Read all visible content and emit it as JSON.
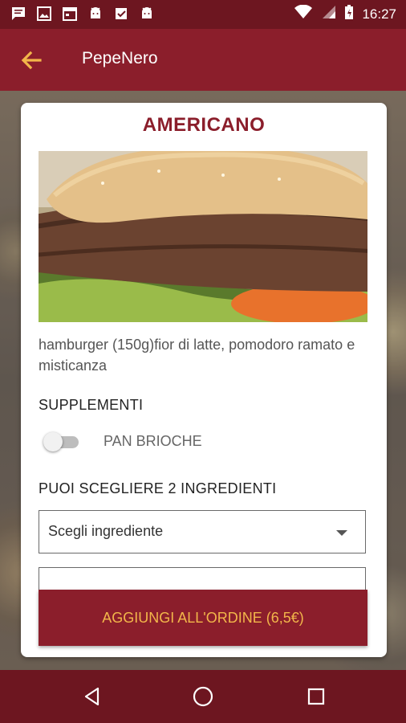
{
  "status_bar": {
    "time": "16:27",
    "left_icons": [
      "message-icon",
      "image-icon",
      "calendar-icon",
      "android-icon",
      "check-flag-icon",
      "android-icon"
    ],
    "right_icons": [
      "wifi-icon",
      "signal-icon",
      "battery-charging-icon"
    ]
  },
  "app_bar": {
    "title": "PepeNero",
    "back_icon": "arrow-left-icon"
  },
  "card": {
    "title": "AMERICANO",
    "description": "hamburger (150g)fior di latte, pomodoro ramato e misticanza",
    "supplements_label": "SUPPLEMENTI",
    "supplement": {
      "label": "PAN BRIOCHE",
      "enabled": false
    },
    "ingredients_label": "PUOI SCEGLIERE 2 INGREDIENTI",
    "ingredient_select_1": "Scegli ingrediente",
    "order_button": "AGGIUNGI ALL'ORDINE (6,5€)"
  },
  "nav_bar": {
    "buttons": [
      "back-triangle-icon",
      "home-circle-icon",
      "recents-square-icon"
    ]
  },
  "colors": {
    "primary": "#8b1e2b",
    "primary_dark": "#6d1620",
    "accent": "#f2b64a",
    "back_arrow": "#f2b64a"
  }
}
